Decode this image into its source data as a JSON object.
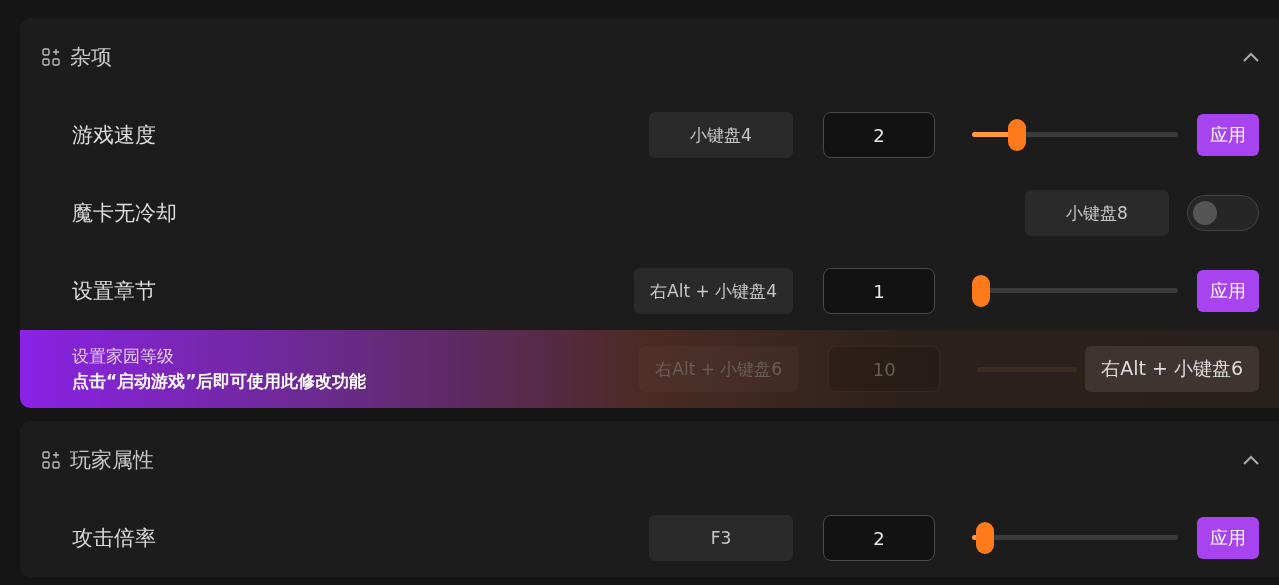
{
  "sections": [
    {
      "title": "杂项",
      "expanded": true,
      "rows": [
        {
          "kind": "slider",
          "label": "游戏速度",
          "hotkey": "小键盘4",
          "value": "2",
          "level": 0.19,
          "button": "应用"
        },
        {
          "kind": "toggle",
          "label": "魔卡无冷却",
          "hotkey": "小键盘8",
          "on": false
        },
        {
          "kind": "slider",
          "label": "设置章节",
          "hotkey": "右Alt + 小键盘4",
          "value": "1",
          "level": 0,
          "button": "应用"
        },
        {
          "kind": "locked",
          "label": "设置家园等级",
          "notice": "点击“启动游戏”后即可使用此修改功能",
          "hotkey": "右Alt + 小键盘6",
          "value": "10",
          "unlock_hotkey": "右Alt + 小键盘6"
        }
      ]
    },
    {
      "title": "玩家属性",
      "expanded": true,
      "rows": [
        {
          "kind": "slider",
          "label": "攻击倍率",
          "hotkey": "F3",
          "value": "2",
          "level": 0.02,
          "button": "应用"
        }
      ]
    }
  ]
}
